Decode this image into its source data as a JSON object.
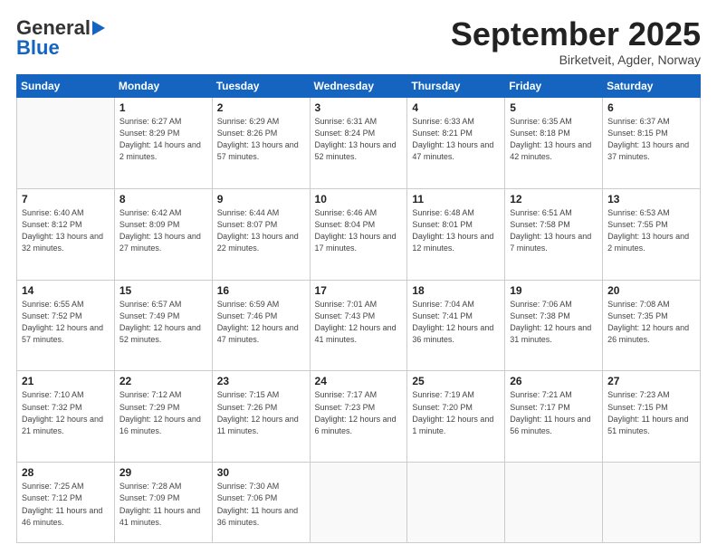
{
  "logo": {
    "general": "General",
    "blue": "Blue"
  },
  "title": "September 2025",
  "location": "Birketveit, Agder, Norway",
  "headers": [
    "Sunday",
    "Monday",
    "Tuesday",
    "Wednesday",
    "Thursday",
    "Friday",
    "Saturday"
  ],
  "weeks": [
    [
      {
        "day": "",
        "info": ""
      },
      {
        "day": "1",
        "info": "Sunrise: 6:27 AM\nSunset: 8:29 PM\nDaylight: 14 hours\nand 2 minutes."
      },
      {
        "day": "2",
        "info": "Sunrise: 6:29 AM\nSunset: 8:26 PM\nDaylight: 13 hours\nand 57 minutes."
      },
      {
        "day": "3",
        "info": "Sunrise: 6:31 AM\nSunset: 8:24 PM\nDaylight: 13 hours\nand 52 minutes."
      },
      {
        "day": "4",
        "info": "Sunrise: 6:33 AM\nSunset: 8:21 PM\nDaylight: 13 hours\nand 47 minutes."
      },
      {
        "day": "5",
        "info": "Sunrise: 6:35 AM\nSunset: 8:18 PM\nDaylight: 13 hours\nand 42 minutes."
      },
      {
        "day": "6",
        "info": "Sunrise: 6:37 AM\nSunset: 8:15 PM\nDaylight: 13 hours\nand 37 minutes."
      }
    ],
    [
      {
        "day": "7",
        "info": "Sunrise: 6:40 AM\nSunset: 8:12 PM\nDaylight: 13 hours\nand 32 minutes."
      },
      {
        "day": "8",
        "info": "Sunrise: 6:42 AM\nSunset: 8:09 PM\nDaylight: 13 hours\nand 27 minutes."
      },
      {
        "day": "9",
        "info": "Sunrise: 6:44 AM\nSunset: 8:07 PM\nDaylight: 13 hours\nand 22 minutes."
      },
      {
        "day": "10",
        "info": "Sunrise: 6:46 AM\nSunset: 8:04 PM\nDaylight: 13 hours\nand 17 minutes."
      },
      {
        "day": "11",
        "info": "Sunrise: 6:48 AM\nSunset: 8:01 PM\nDaylight: 13 hours\nand 12 minutes."
      },
      {
        "day": "12",
        "info": "Sunrise: 6:51 AM\nSunset: 7:58 PM\nDaylight: 13 hours\nand 7 minutes."
      },
      {
        "day": "13",
        "info": "Sunrise: 6:53 AM\nSunset: 7:55 PM\nDaylight: 13 hours\nand 2 minutes."
      }
    ],
    [
      {
        "day": "14",
        "info": "Sunrise: 6:55 AM\nSunset: 7:52 PM\nDaylight: 12 hours\nand 57 minutes."
      },
      {
        "day": "15",
        "info": "Sunrise: 6:57 AM\nSunset: 7:49 PM\nDaylight: 12 hours\nand 52 minutes."
      },
      {
        "day": "16",
        "info": "Sunrise: 6:59 AM\nSunset: 7:46 PM\nDaylight: 12 hours\nand 47 minutes."
      },
      {
        "day": "17",
        "info": "Sunrise: 7:01 AM\nSunset: 7:43 PM\nDaylight: 12 hours\nand 41 minutes."
      },
      {
        "day": "18",
        "info": "Sunrise: 7:04 AM\nSunset: 7:41 PM\nDaylight: 12 hours\nand 36 minutes."
      },
      {
        "day": "19",
        "info": "Sunrise: 7:06 AM\nSunset: 7:38 PM\nDaylight: 12 hours\nand 31 minutes."
      },
      {
        "day": "20",
        "info": "Sunrise: 7:08 AM\nSunset: 7:35 PM\nDaylight: 12 hours\nand 26 minutes."
      }
    ],
    [
      {
        "day": "21",
        "info": "Sunrise: 7:10 AM\nSunset: 7:32 PM\nDaylight: 12 hours\nand 21 minutes."
      },
      {
        "day": "22",
        "info": "Sunrise: 7:12 AM\nSunset: 7:29 PM\nDaylight: 12 hours\nand 16 minutes."
      },
      {
        "day": "23",
        "info": "Sunrise: 7:15 AM\nSunset: 7:26 PM\nDaylight: 12 hours\nand 11 minutes."
      },
      {
        "day": "24",
        "info": "Sunrise: 7:17 AM\nSunset: 7:23 PM\nDaylight: 12 hours\nand 6 minutes."
      },
      {
        "day": "25",
        "info": "Sunrise: 7:19 AM\nSunset: 7:20 PM\nDaylight: 12 hours\nand 1 minute."
      },
      {
        "day": "26",
        "info": "Sunrise: 7:21 AM\nSunset: 7:17 PM\nDaylight: 11 hours\nand 56 minutes."
      },
      {
        "day": "27",
        "info": "Sunrise: 7:23 AM\nSunset: 7:15 PM\nDaylight: 11 hours\nand 51 minutes."
      }
    ],
    [
      {
        "day": "28",
        "info": "Sunrise: 7:25 AM\nSunset: 7:12 PM\nDaylight: 11 hours\nand 46 minutes."
      },
      {
        "day": "29",
        "info": "Sunrise: 7:28 AM\nSunset: 7:09 PM\nDaylight: 11 hours\nand 41 minutes."
      },
      {
        "day": "30",
        "info": "Sunrise: 7:30 AM\nSunset: 7:06 PM\nDaylight: 11 hours\nand 36 minutes."
      },
      {
        "day": "",
        "info": ""
      },
      {
        "day": "",
        "info": ""
      },
      {
        "day": "",
        "info": ""
      },
      {
        "day": "",
        "info": ""
      }
    ]
  ]
}
